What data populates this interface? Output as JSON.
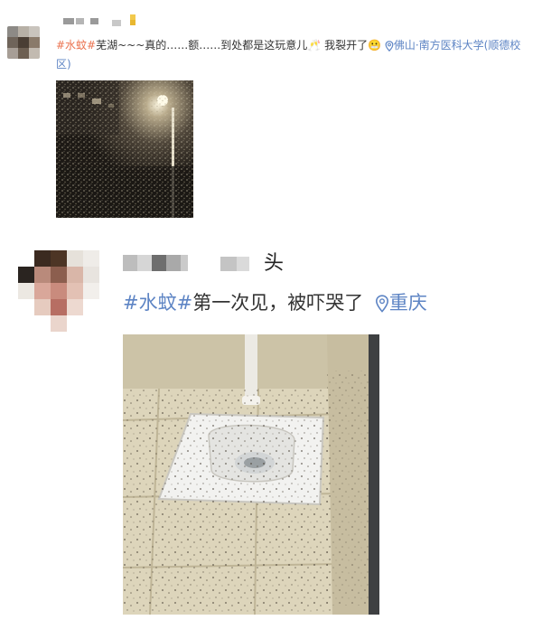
{
  "post1": {
    "hashtag": "#水蚊#",
    "text": "芜湖~~~真的……额……到处都是这玩意儿",
    "emoji_after_text": "🥂",
    "text2": " 我裂开了",
    "emoji_end": "😬",
    "location": "佛山·南方医科大学(顺德校区)",
    "location_icon": "location-pin-icon"
  },
  "post2": {
    "username_suffix": "头",
    "hashtag": "#水蚊#",
    "text": "第一次见，被吓哭了",
    "location": "重庆",
    "location_icon": "location-pin-icon"
  },
  "colors": {
    "hashtag": "#eb7350",
    "link": "#5d84c4",
    "text": "#333333"
  }
}
